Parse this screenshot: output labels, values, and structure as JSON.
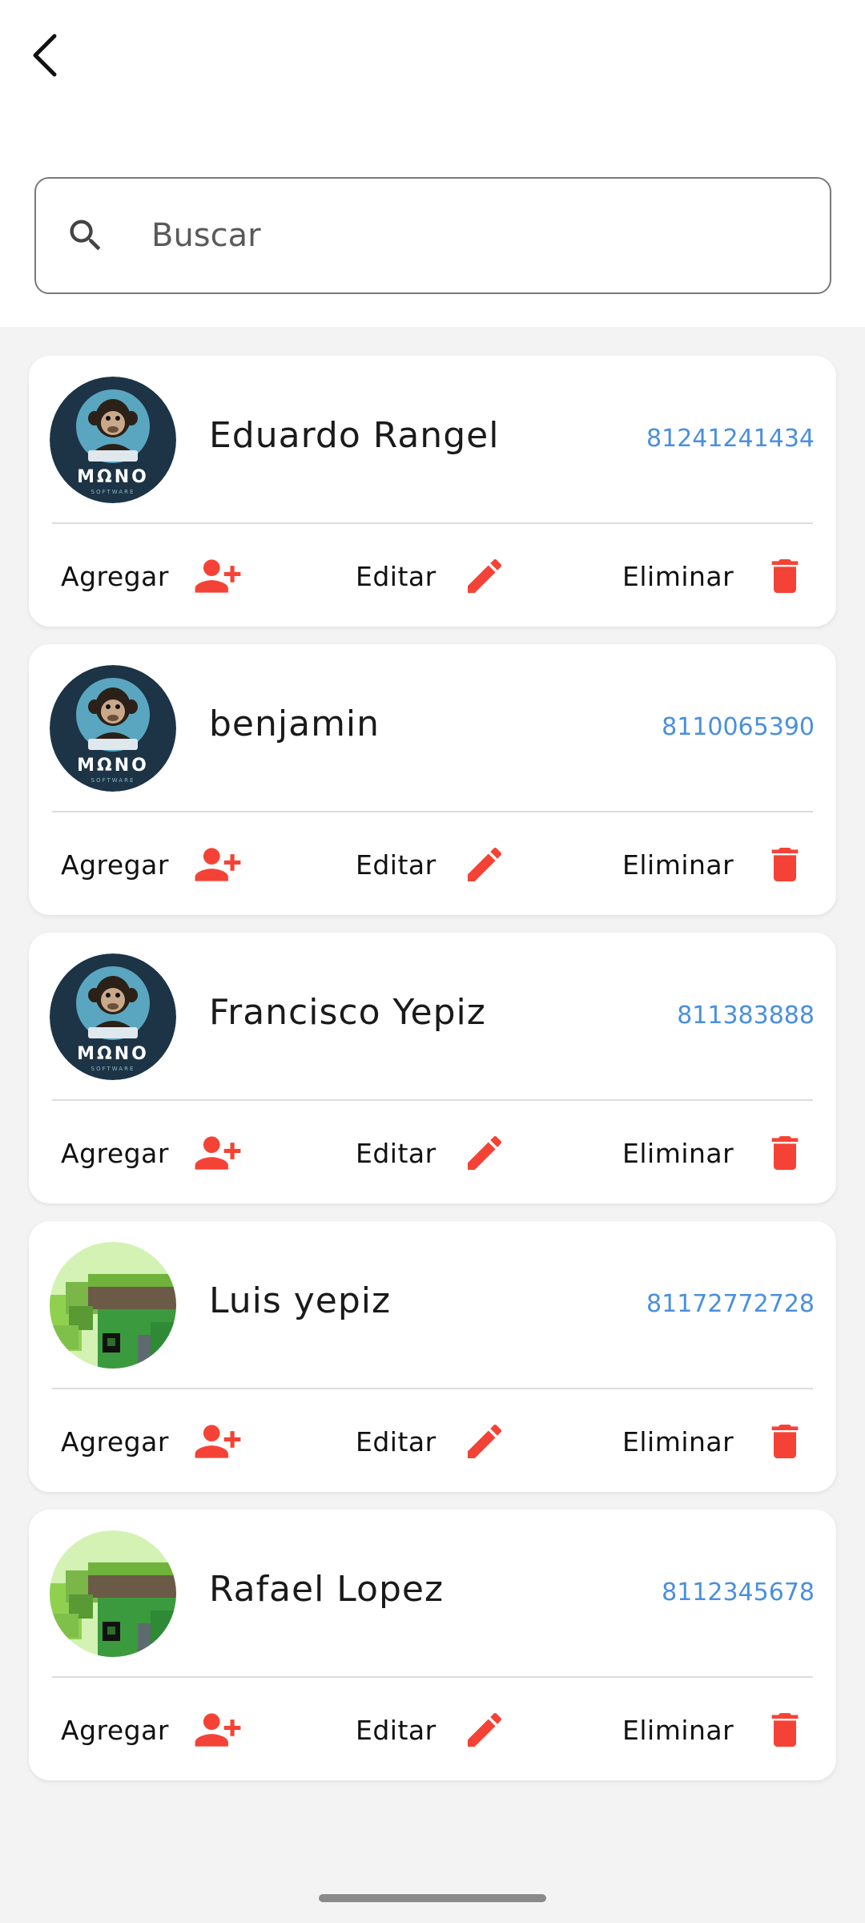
{
  "header": {
    "back_icon": "chevron-left-icon"
  },
  "search": {
    "placeholder": "Buscar",
    "value": "",
    "icon": "search-icon"
  },
  "actions": {
    "add_label": "Agregar",
    "edit_label": "Editar",
    "delete_label": "Eliminar",
    "add_icon": "person-add-icon",
    "edit_icon": "pencil-icon",
    "delete_icon": "trash-icon",
    "icon_color": "#f44336"
  },
  "contacts": [
    {
      "name": "Eduardo Rangel",
      "phone": "81241241434",
      "avatar": "mono-software-logo"
    },
    {
      "name": "benjamin",
      "phone": "8110065390",
      "avatar": "mono-software-logo"
    },
    {
      "name": "Francisco Yepiz",
      "phone": "811383888",
      "avatar": "mono-software-logo"
    },
    {
      "name": "Luis yepiz",
      "phone": "81172772728",
      "avatar": "pixel-art-avatar"
    },
    {
      "name": "Rafael Lopez",
      "phone": "8112345678",
      "avatar": "pixel-art-avatar"
    }
  ],
  "colors": {
    "phone_link": "#4a8fe0",
    "list_background": "#f3f3f3",
    "accent_red": "#f44336"
  }
}
